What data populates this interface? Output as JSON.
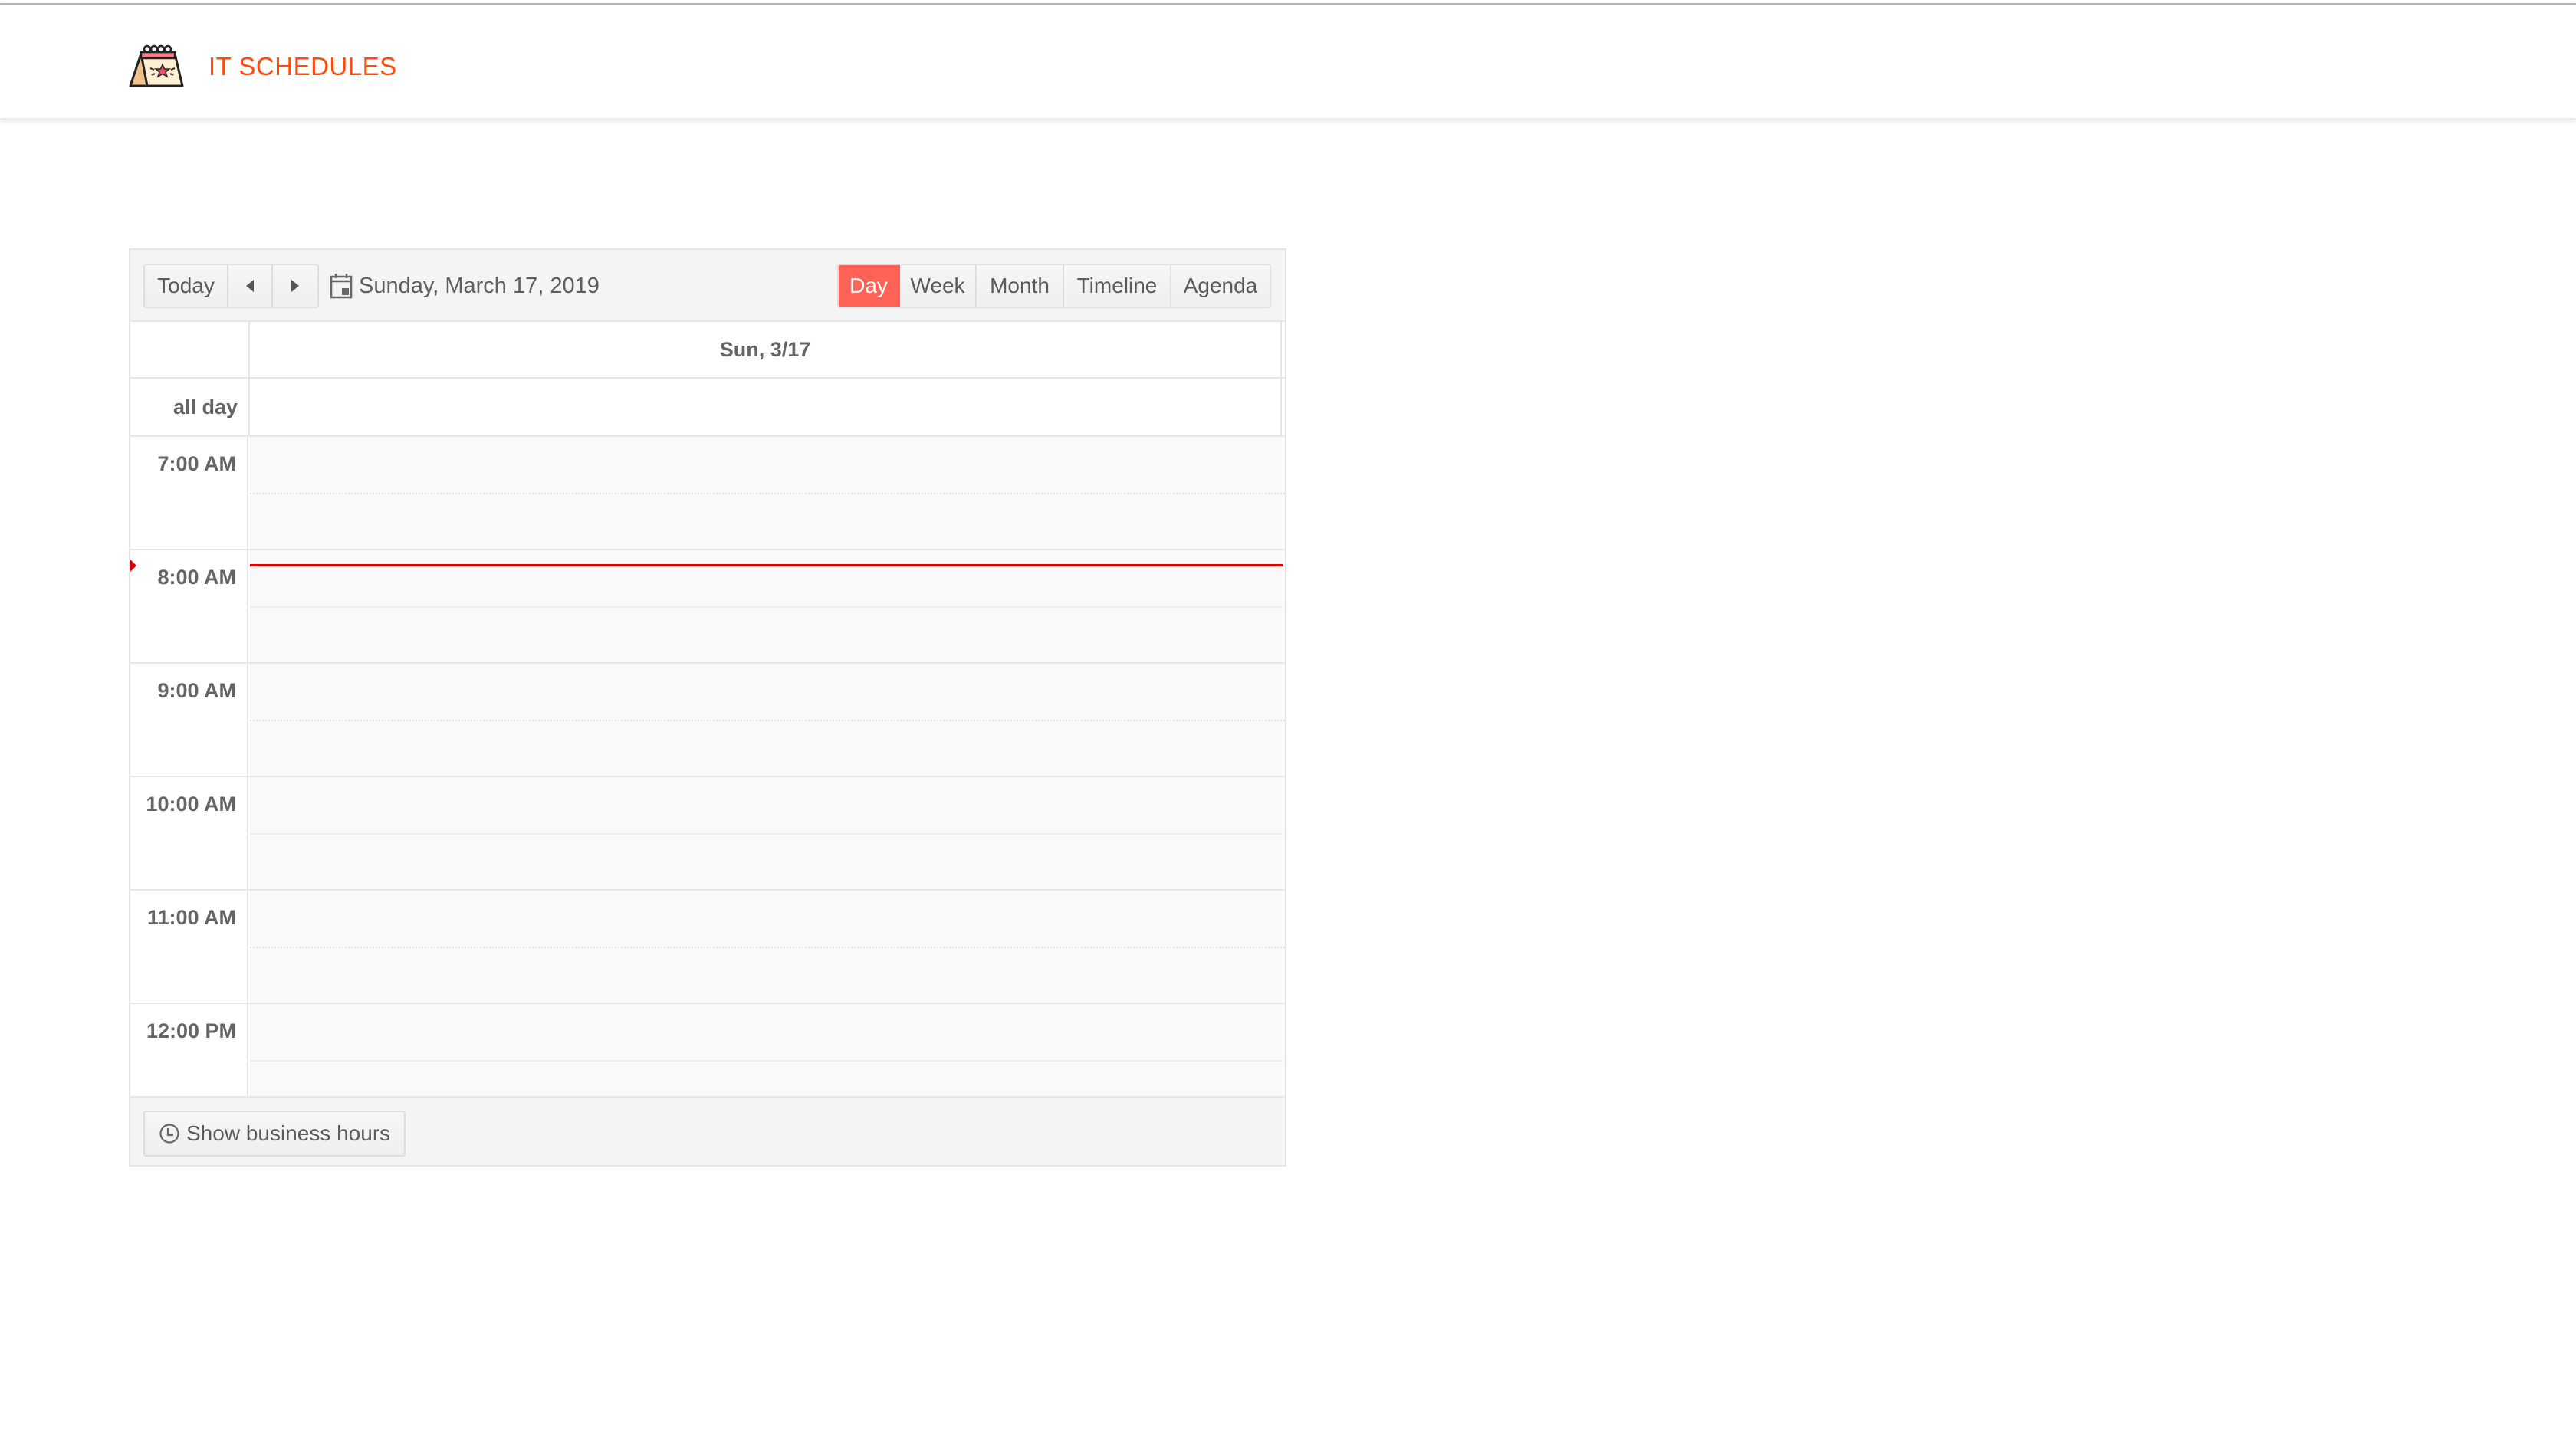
{
  "app": {
    "title": "IT SCHEDULES",
    "logo_icon": "calendar-star-icon",
    "accent_color": "#ff4a0a"
  },
  "scheduler": {
    "toolbar": {
      "today_label": "Today",
      "prev_icon": "caret-left-icon",
      "next_icon": "caret-right-icon",
      "date_icon": "calendar-icon",
      "current_date": "Sunday, March 17, 2019",
      "views": [
        {
          "label": "Day",
          "selected": true
        },
        {
          "label": "Week",
          "selected": false
        },
        {
          "label": "Month",
          "selected": false
        },
        {
          "label": "Timeline",
          "selected": false
        },
        {
          "label": "Agenda",
          "selected": false
        }
      ],
      "selected_color": "#ff6358"
    },
    "day_header": "Sun, 3/17",
    "all_day_label": "all day",
    "time_slots": [
      "7:00 AM",
      "8:00 AM",
      "9:00 AM",
      "10:00 AM",
      "11:00 AM",
      "12:00 PM"
    ],
    "current_time_indicator_color": "#e10000",
    "events": [],
    "footer": {
      "business_hours_label": "Show business hours",
      "business_hours_icon": "clock-icon"
    }
  }
}
